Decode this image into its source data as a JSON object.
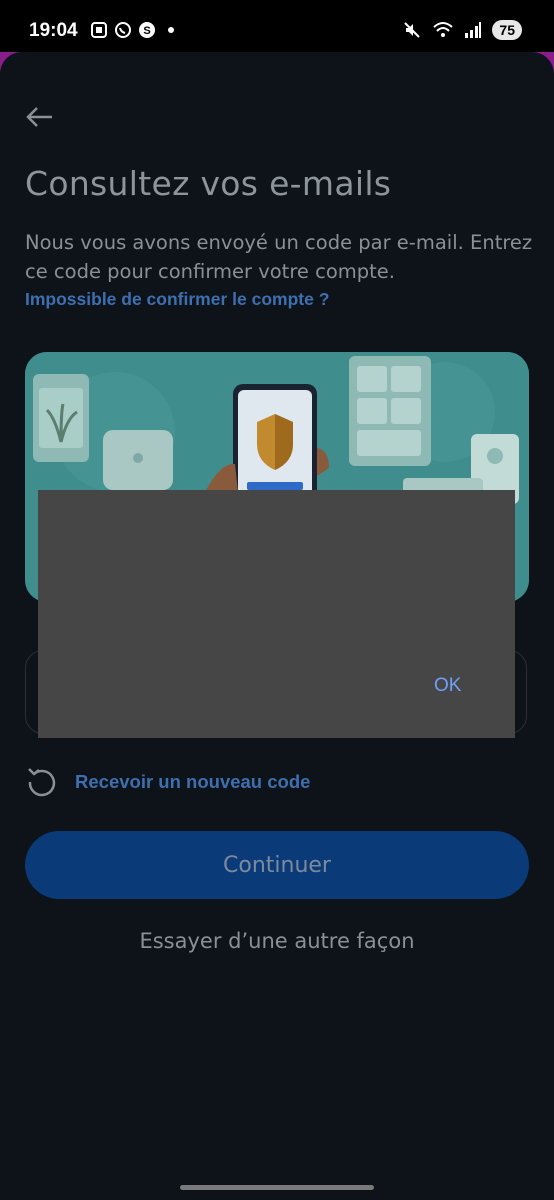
{
  "status_bar": {
    "time": "19:04",
    "left_icons": [
      "screenshot-icon",
      "whatsapp-icon",
      "skype-icon",
      "dot-icon"
    ],
    "right_icons": [
      "mute-icon",
      "wifi-icon",
      "signal-icon"
    ],
    "battery": "75"
  },
  "page": {
    "title": "Consultez vos e-mails",
    "subtitle": "Nous vous avons envoyé un code par e-mail. Entrez ce code pour confirmer votre compte.",
    "help_link": "Impossible de confirmer le compte ?",
    "resend_label": "Recevoir un nouveau code",
    "continue_label": "Continuer",
    "alt_link": "Essayer d’une autre façon"
  },
  "dialog": {
    "ok_label": "OK"
  },
  "colors": {
    "background": "#0d1318",
    "link": "#3e6fb0",
    "primary_button": "#0a3a78",
    "dialog_bg": "#464646",
    "dialog_ok": "#6fa0f5"
  }
}
